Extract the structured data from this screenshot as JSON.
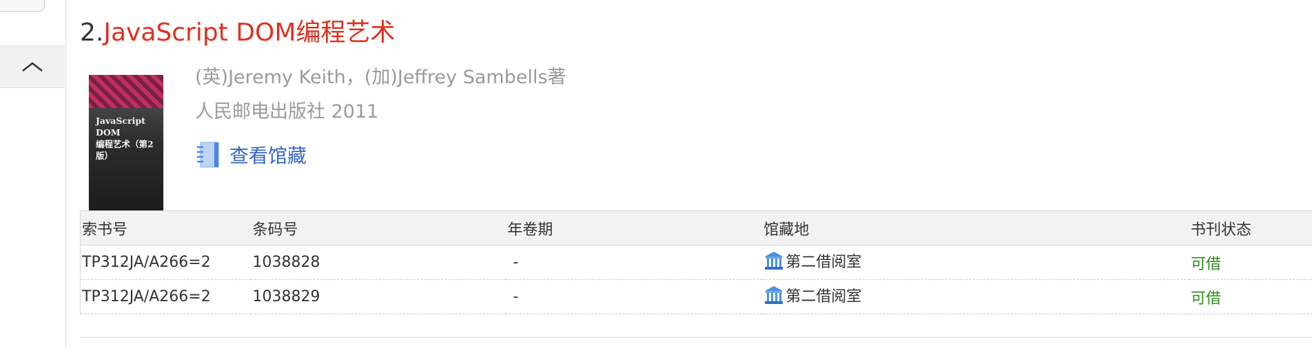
{
  "book": {
    "index_label": "2.",
    "title": "JavaScript DOM编程艺术",
    "authors": "(英)Jeremy Keith，(加)Jeffrey Sambells著",
    "publisher_year": "人民邮电出版社 2011",
    "view_holdings_label": "查看馆藏",
    "cover": {
      "line1": "JavaScript DOM",
      "line2": "编程艺术（第2版）"
    }
  },
  "holdings": {
    "headers": {
      "call_number": "索书号",
      "barcode": "条码号",
      "volume": "年卷期",
      "location": "馆藏地",
      "status": "书刊状态"
    },
    "rows": [
      {
        "call_number": "TP312JA/A266=2",
        "barcode": "1038828",
        "volume": "-",
        "location": "第二借阅室",
        "status": "可借"
      },
      {
        "call_number": "TP312JA/A266=2",
        "barcode": "1038829",
        "volume": "-",
        "location": "第二借阅室",
        "status": "可借"
      }
    ]
  },
  "colors": {
    "title_red": "#e0301e",
    "link_blue": "#3565c5",
    "status_green": "#2e8b1f"
  },
  "icons": {
    "collapse": "chevron-up-icon",
    "view_holdings": "notebook-icon",
    "location": "library-building-icon"
  }
}
